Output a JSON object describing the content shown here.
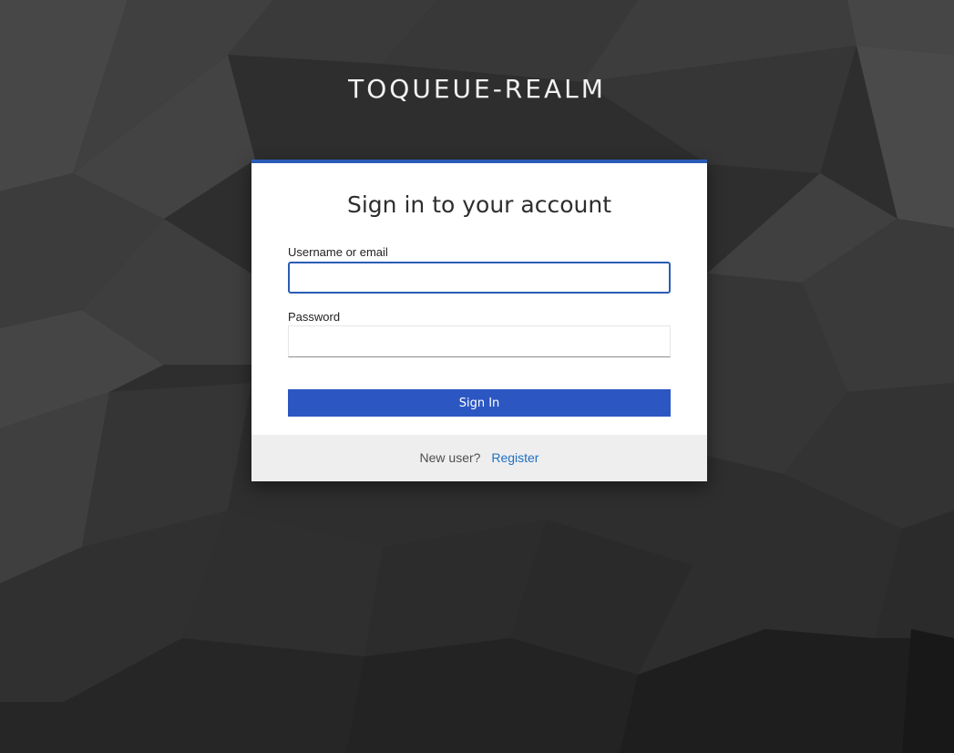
{
  "realm": {
    "title": "TOQUEUE-REALM"
  },
  "login": {
    "heading": "Sign in to your account",
    "username_label": "Username or email",
    "username_value": "",
    "password_label": "Password",
    "password_value": "",
    "submit_label": "Sign In"
  },
  "footer": {
    "new_user_text": "New user?",
    "register_label": "Register"
  },
  "colors": {
    "accent": "#2b5cb5",
    "button": "#2c57c2",
    "link": "#1f6fc4",
    "background": "#2b2b2b",
    "footer_bg": "#eeeeee"
  }
}
